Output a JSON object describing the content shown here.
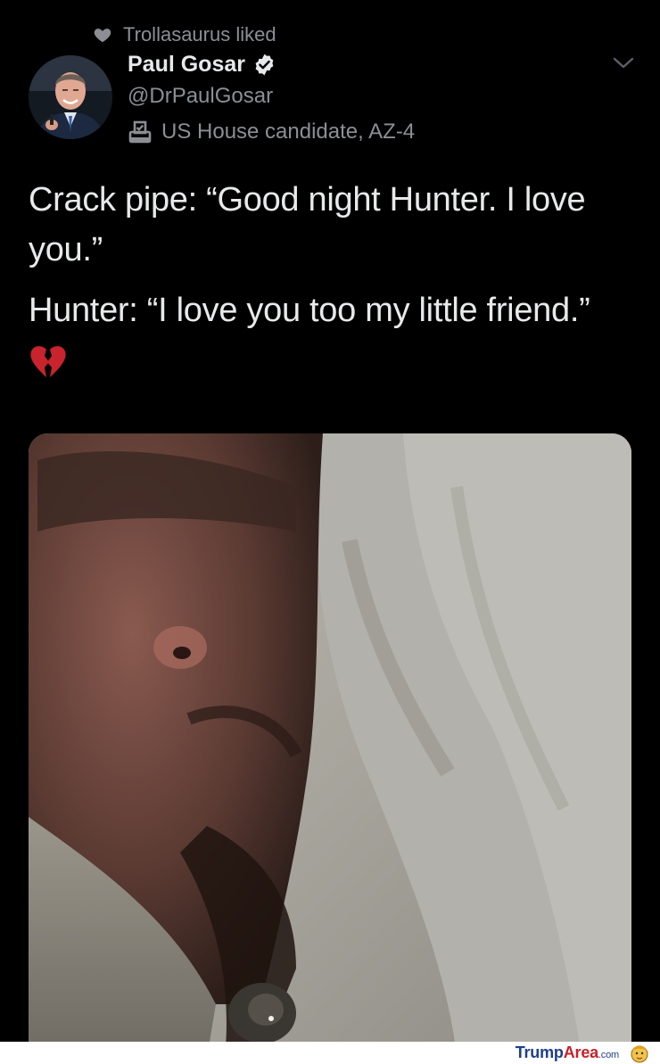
{
  "social_context": {
    "text": "Trollasaurus liked",
    "icon": "heart-icon"
  },
  "author": {
    "display_name": "Paul Gosar",
    "handle": "@DrPaulGosar",
    "label": "US House candidate, AZ-4",
    "verified": true,
    "label_icon": "ballot-box-icon"
  },
  "tweet": {
    "line1": "Crack pipe: “Good night Hunter. I love you.”",
    "line2": "Hunter: “I love you too my little friend.”",
    "emoji": "broken-heart-icon"
  },
  "menu": {
    "icon": "chevron-down-icon"
  },
  "watermark": {
    "brand_a": "Trump",
    "brand_b": "Area",
    "suffix": ".com"
  },
  "colors": {
    "background": "#000000",
    "text_primary": "#e7e9ea",
    "text_secondary": "#8b8f94",
    "watermark_blue": "#1f3f8c",
    "watermark_red": "#c8202a"
  }
}
